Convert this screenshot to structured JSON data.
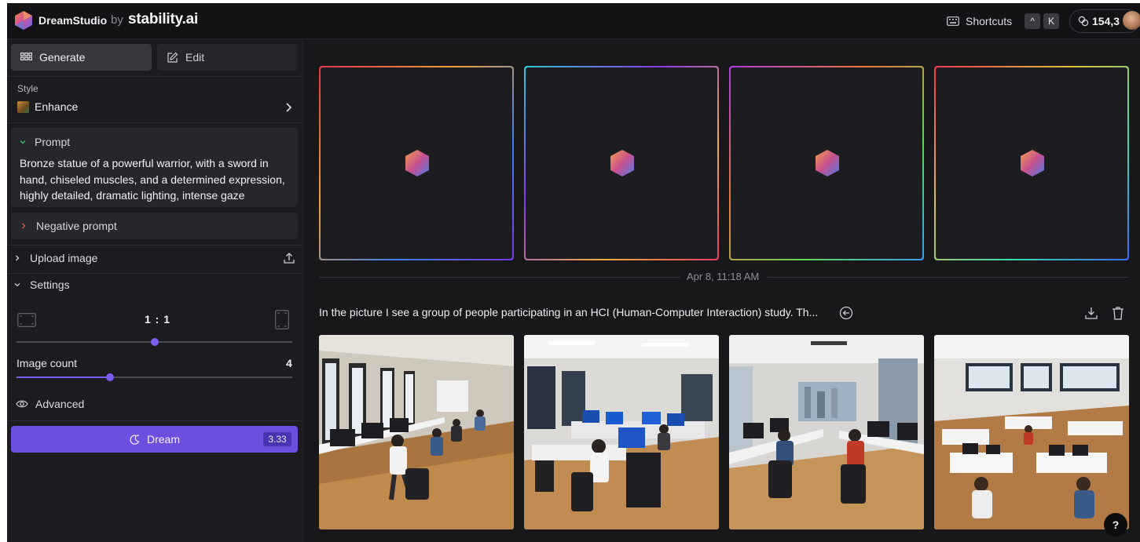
{
  "header": {
    "brand": "DreamStudio",
    "brand_by": "by",
    "brand_company": "stability.ai",
    "shortcuts_label": "Shortcuts",
    "shortcut_keys": [
      "^",
      "K"
    ],
    "credits": "154,3",
    "icons": [
      "logo-icon",
      "keyboard-icon",
      "credits-icon",
      "avatar"
    ]
  },
  "sidebar": {
    "tabs": [
      {
        "label": "Generate",
        "icon": "grid-icon",
        "active": true
      },
      {
        "label": "Edit",
        "icon": "edit-icon",
        "active": false
      }
    ],
    "style": {
      "label": "Style",
      "value": "Enhance"
    },
    "prompt": {
      "label": "Prompt",
      "text": "Bronze statue of a powerful warrior, with a sword in hand, chiseled muscles, and a determined expression, highly detailed, dramatic lighting, intense gaze"
    },
    "negative_prompt": {
      "label": "Negative prompt"
    },
    "upload_image": {
      "label": "Upload image"
    },
    "settings": {
      "label": "Settings",
      "aspect_ratio": "1 : 1",
      "aspect_slider_fraction": 0.5,
      "image_count_label": "Image count",
      "image_count": "4",
      "image_count_fraction": 0.34,
      "advanced_label": "Advanced"
    },
    "dream_button": {
      "label": "Dream",
      "cost": "3.33"
    }
  },
  "main": {
    "pending_slots": 4,
    "timestamp": "Apr 8, 11:18 AM",
    "caption": "In the picture I see a group of people participating in an HCI (Human-Computer Interaction) study. Th...",
    "result_images": 4,
    "help_label": "?"
  },
  "colors": {
    "accent": "#6d4fe0",
    "background": "#18181b",
    "sidebar": "#1c1c20",
    "panel": "#26262b"
  }
}
